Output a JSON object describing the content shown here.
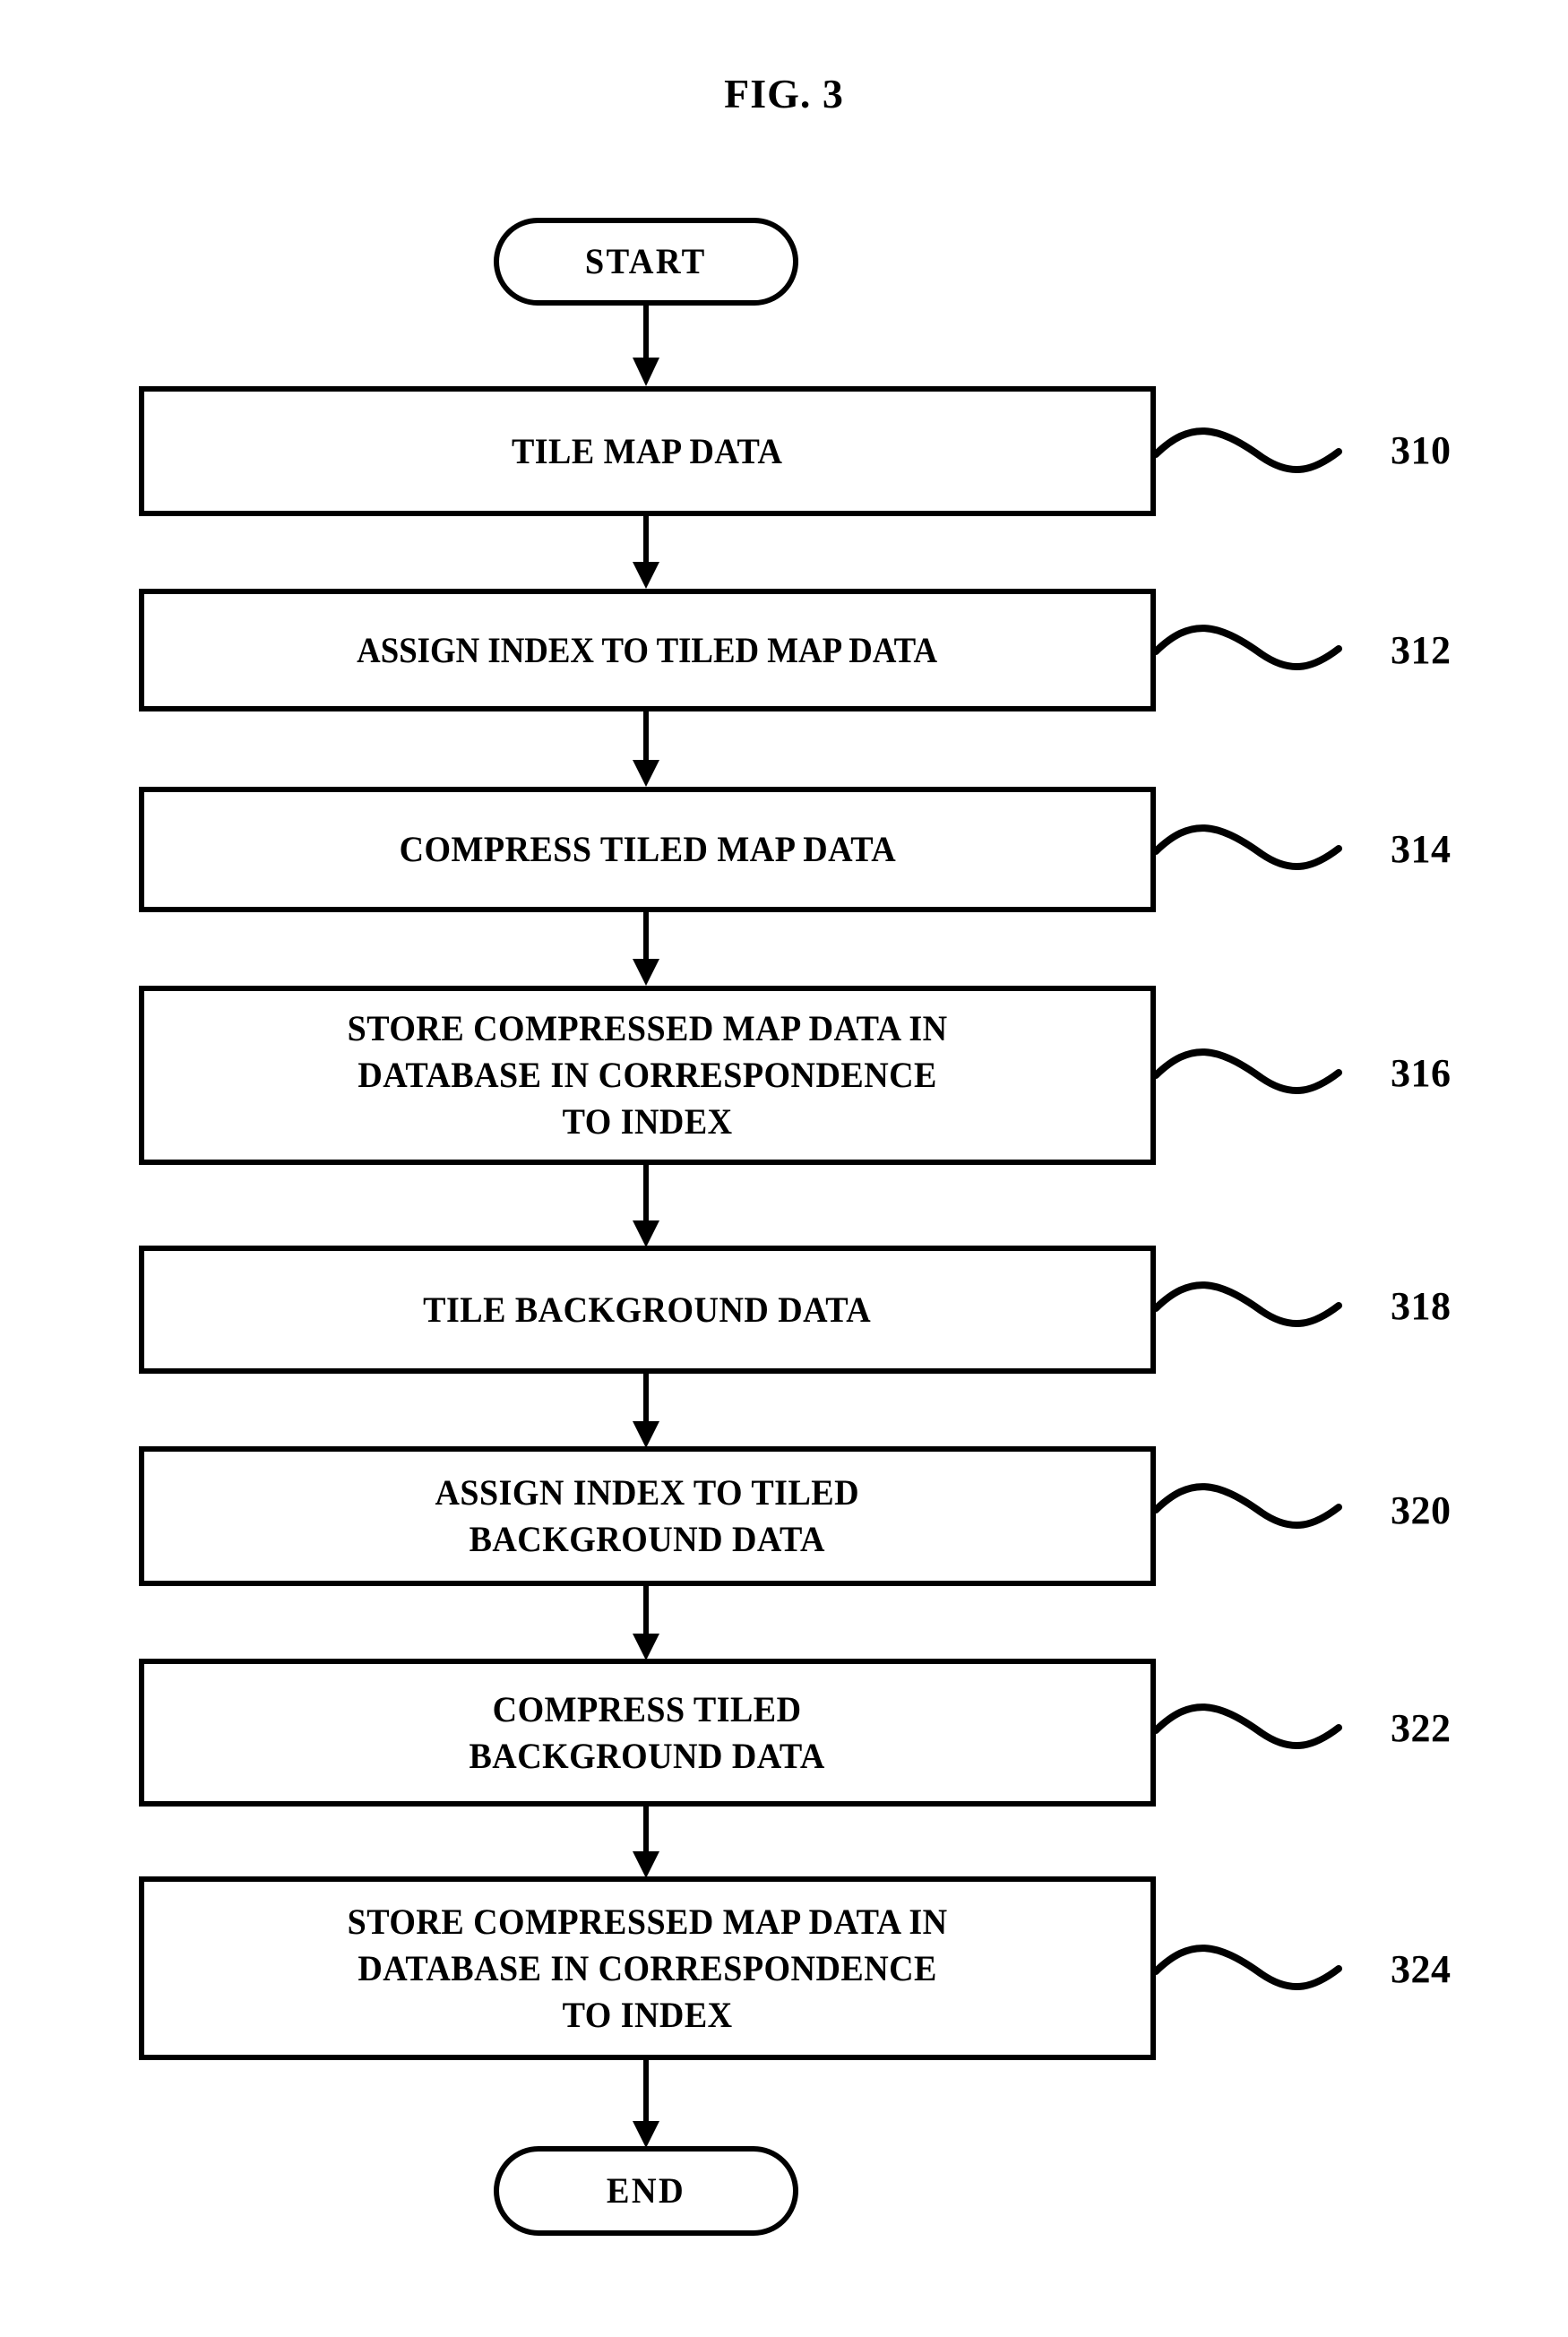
{
  "figure": {
    "title": "FIG. 3",
    "line_color": "#000000",
    "background_color": "#ffffff"
  },
  "nodes": {
    "start": {
      "label": "START",
      "shape": "stadium"
    },
    "end": {
      "label": "END",
      "shape": "stadium"
    }
  },
  "steps": [
    {
      "ref": "310",
      "text": "TILE MAP DATA",
      "lines": 1
    },
    {
      "ref": "312",
      "text": "ASSIGN INDEX TO TILED MAP DATA",
      "lines": 1
    },
    {
      "ref": "314",
      "text": "COMPRESS TILED MAP DATA",
      "lines": 1
    },
    {
      "ref": "316",
      "text": "STORE COMPRESSED MAP DATA IN\nDATABASE IN CORRESPONDENCE\nTO INDEX",
      "lines": 3
    },
    {
      "ref": "318",
      "text": "TILE BACKGROUND DATA",
      "lines": 1
    },
    {
      "ref": "320",
      "text": "ASSIGN INDEX TO TILED\nBACKGROUND DATA",
      "lines": 2
    },
    {
      "ref": "322",
      "text": "COMPRESS TILED\nBACKGROUND DATA",
      "lines": 2
    },
    {
      "ref": "324",
      "text": "STORE COMPRESSED MAP DATA IN\nDATABASE IN CORRESPONDENCE\nTO INDEX",
      "lines": 3
    }
  ],
  "chart_data": {
    "type": "diagram",
    "diagram_type": "flowchart",
    "title": "FIG. 3",
    "orientation": "top-to-bottom",
    "nodes": [
      {
        "id": "start",
        "label": "START",
        "shape": "stadium",
        "ref": null
      },
      {
        "id": "s310",
        "label": "TILE MAP DATA",
        "shape": "rectangle",
        "ref": "310"
      },
      {
        "id": "s312",
        "label": "ASSIGN INDEX TO TILED MAP DATA",
        "shape": "rectangle",
        "ref": "312"
      },
      {
        "id": "s314",
        "label": "COMPRESS TILED MAP DATA",
        "shape": "rectangle",
        "ref": "314"
      },
      {
        "id": "s316",
        "label": "STORE COMPRESSED MAP DATA IN DATABASE IN CORRESPONDENCE TO INDEX",
        "shape": "rectangle",
        "ref": "316"
      },
      {
        "id": "s318",
        "label": "TILE BACKGROUND DATA",
        "shape": "rectangle",
        "ref": "318"
      },
      {
        "id": "s320",
        "label": "ASSIGN INDEX TO TILED BACKGROUND DATA",
        "shape": "rectangle",
        "ref": "320"
      },
      {
        "id": "s322",
        "label": "COMPRESS TILED BACKGROUND DATA",
        "shape": "rectangle",
        "ref": "322"
      },
      {
        "id": "s324",
        "label": "STORE COMPRESSED MAP DATA IN DATABASE IN CORRESPONDENCE TO INDEX",
        "shape": "rectangle",
        "ref": "324"
      },
      {
        "id": "end",
        "label": "END",
        "shape": "stadium",
        "ref": null
      }
    ],
    "edges": [
      {
        "from": "start",
        "to": "s310",
        "label": "",
        "arrow": true
      },
      {
        "from": "s310",
        "to": "s312",
        "label": "",
        "arrow": true
      },
      {
        "from": "s312",
        "to": "s314",
        "label": "",
        "arrow": true
      },
      {
        "from": "s314",
        "to": "s316",
        "label": "",
        "arrow": true
      },
      {
        "from": "s316",
        "to": "s318",
        "label": "",
        "arrow": true
      },
      {
        "from": "s318",
        "to": "s320",
        "label": "",
        "arrow": true
      },
      {
        "from": "s320",
        "to": "s322",
        "label": "",
        "arrow": true
      },
      {
        "from": "s322",
        "to": "s324",
        "label": "",
        "arrow": true
      },
      {
        "from": "s324",
        "to": "end",
        "label": "",
        "arrow": true
      }
    ],
    "reference_numerals": [
      "310",
      "312",
      "314",
      "316",
      "318",
      "320",
      "322",
      "324"
    ]
  }
}
